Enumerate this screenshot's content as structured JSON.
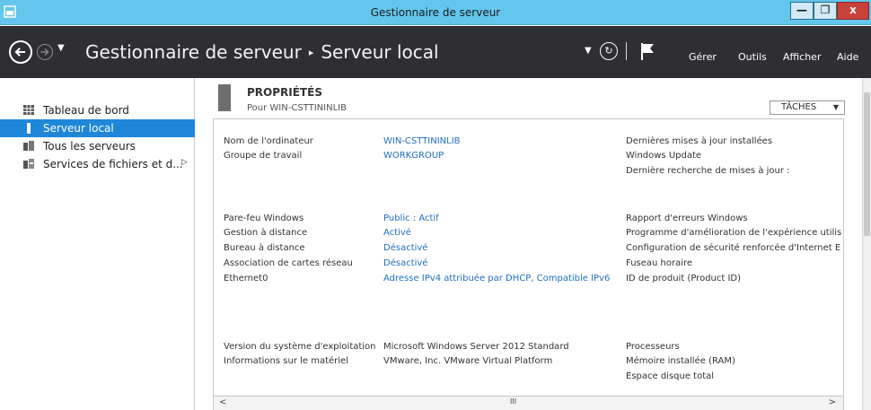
{
  "window": {
    "title": "Gestionnaire de serveur",
    "min_glyph": "—",
    "max_glyph": "❐",
    "close_glyph": "x",
    "app_icon": "server-manager-icon"
  },
  "header": {
    "breadcrumb_root": "Gestionnaire de serveur",
    "breadcrumb_sep": "▸",
    "breadcrumb_current": "Serveur local",
    "refresh_glyph": "↻",
    "menus": [
      "Gérer",
      "Outils",
      "Afficher",
      "Aide"
    ]
  },
  "sidebar": {
    "items": [
      {
        "label": "Tableau de bord",
        "icon": "dashboard-icon"
      },
      {
        "label": "Serveur local",
        "icon": "local-server-icon",
        "active": true
      },
      {
        "label": "Tous les serveurs",
        "icon": "all-servers-icon"
      },
      {
        "label": "Services de fichiers et d...",
        "icon": "file-services-icon",
        "arrow": "▷"
      }
    ]
  },
  "properties": {
    "title": "PROPRIÉTÉS",
    "subtitle": "Pour WIN-CSTTININLIB",
    "tasks_label": "TÂCHES",
    "tasks_caret": "▼",
    "left_labels": [
      "Nom de l'ordinateur",
      "Groupe de travail",
      "Pare-feu Windows",
      "Gestion à distance",
      "Bureau à distance",
      "Association de cartes réseau",
      "Ethernet0",
      "Version du système d'exploitation",
      "Informations sur le matériel"
    ],
    "left_values": [
      "WIN-CSTTININLIB",
      "WORKGROUP",
      "Public : Actif",
      "Activé",
      "Désactivé",
      "Désactivé",
      "Adresse IPv4 attribuée par DHCP, Compatible IPv6",
      "Microsoft Windows Server 2012 Standard",
      "VMware, Inc. VMware Virtual Platform"
    ],
    "right_labels": [
      "Dernières mises à jour installées",
      "Windows Update",
      "Dernière recherche de mises à jour :",
      "Rapport d'erreurs Windows",
      "Programme d'amélioration de l'expérience utilis",
      "Configuration de sécurité renforcée d'Internet E",
      "Fuseau horaire",
      "ID de produit (Product ID)",
      "Processeurs",
      "Mémoire installée (RAM)",
      "Espace disque total"
    ]
  },
  "scroll": {
    "left_arrow": "<",
    "grip": "III",
    "right_arrow": ">"
  }
}
